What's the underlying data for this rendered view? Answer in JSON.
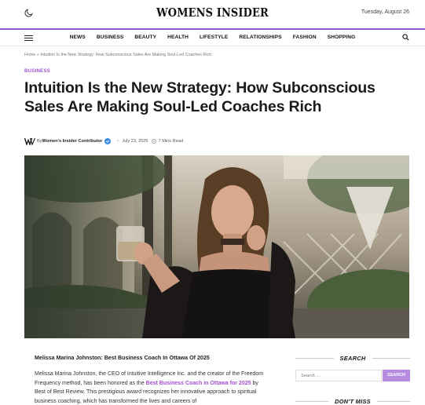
{
  "header": {
    "logo": "WOMENS INSIDER",
    "date": "Tuesday, August 26",
    "icons": [
      "moon-icon",
      "hamburger-icon",
      "search-icon"
    ]
  },
  "nav": {
    "items": [
      "NEWS",
      "BUSINESS",
      "BEAUTY",
      "HEALTH",
      "LIFESTYLE",
      "RELATIONSHIPS",
      "FASHION",
      "SHOPPING"
    ]
  },
  "breadcrumb": "Home » Intuition Is the New Strategy: How Subconscious Sales Are Making Soul-Led Coaches Rich",
  "article": {
    "category": "BUSINESS",
    "title": "Intuition Is the New Strategy: How Subconscious Sales Are Making Soul-Led Coaches Rich",
    "by": "By",
    "author": "Women's Insider Contributor",
    "date": "July 23, 2025",
    "read_time": "7 Mins Read",
    "subheading": "Melissa Marina Johnston: Best Business Coach In Ottawa Of 2025",
    "para_1": "Melissa Marina Johnston, the CEO of Intuitive Intelligence Inc. and the creator of the Freedom Frequency method, has been honored as the",
    "para_link": "Best Business Coach in Ottawa for 2025",
    "para_2": " by Best of Best Review. This prestigious award recognizes her innovative approach to spiritual business coaching, which has transformed the lives and careers of"
  },
  "sidebar": {
    "search_heading": "SEARCH",
    "search_placeholder": "Search ...",
    "search_button": "SEARCH",
    "dont_miss_heading": "DON'T MISS"
  },
  "colors": {
    "accent": "#a24fd1",
    "header_line": "#8b5cd6",
    "search_button": "#b58be0"
  }
}
